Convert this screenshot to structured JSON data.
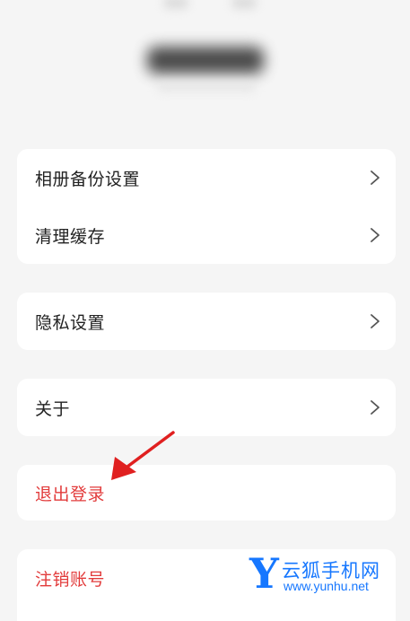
{
  "settings": {
    "group1": [
      {
        "label": "相册备份设置"
      },
      {
        "label": "清理缓存"
      }
    ],
    "privacy": {
      "label": "隐私设置"
    },
    "about": {
      "label": "关于"
    },
    "logout": {
      "label": "退出登录"
    },
    "deactivate": {
      "label": "注销账号"
    }
  },
  "watermark": {
    "letter": "Y",
    "name": "云狐手机网",
    "url": "www.yunhu.net"
  },
  "colors": {
    "background": "#f5f5f5",
    "card": "#ffffff",
    "text": "#222222",
    "danger": "#e23b3b",
    "annotation_arrow": "#e02020",
    "watermark": "#1677ff"
  },
  "icons": {
    "row_chevron": "chevron-right-icon",
    "annotation": "red-arrow-icon"
  }
}
